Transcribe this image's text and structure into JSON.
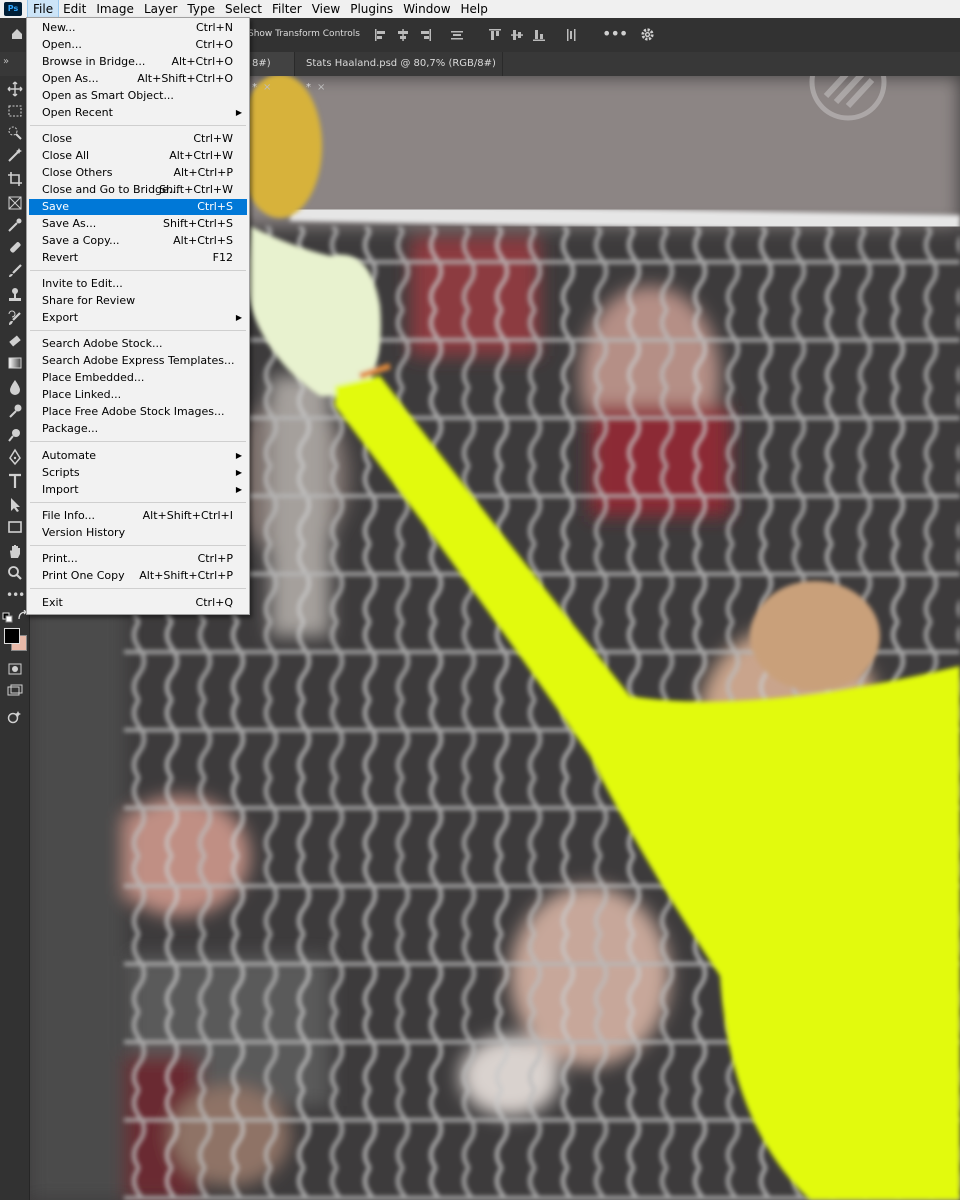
{
  "menubar": {
    "logo": "Ps",
    "items": [
      "File",
      "Edit",
      "Image",
      "Layer",
      "Type",
      "Select",
      "Filter",
      "View",
      "Plugins",
      "Window",
      "Help"
    ]
  },
  "options": {
    "transform_label": "Show Transform Controls"
  },
  "tabs": [
    {
      "label": "8#) *"
    },
    {
      "label": "Stats Haaland.psd @ 80,7% (RGB/8#) *"
    }
  ],
  "file_menu": {
    "items": [
      {
        "label": "New...",
        "shortcut": "Ctrl+N"
      },
      {
        "label": "Open...",
        "shortcut": "Ctrl+O"
      },
      {
        "label": "Browse in Bridge...",
        "shortcut": "Alt+Ctrl+O"
      },
      {
        "label": "Open As...",
        "shortcut": "Alt+Shift+Ctrl+O"
      },
      {
        "label": "Open as Smart Object...",
        "shortcut": ""
      },
      {
        "label": "Open Recent",
        "shortcut": "",
        "submenu": true
      },
      {
        "label": "Close",
        "shortcut": "Ctrl+W"
      },
      {
        "label": "Close All",
        "shortcut": "Alt+Ctrl+W"
      },
      {
        "label": "Close Others",
        "shortcut": "Alt+Ctrl+P"
      },
      {
        "label": "Close and Go to Bridge...",
        "shortcut": "Shift+Ctrl+W"
      },
      {
        "label": "Save",
        "shortcut": "Ctrl+S",
        "highlighted": true
      },
      {
        "label": "Save As...",
        "shortcut": "Shift+Ctrl+S"
      },
      {
        "label": "Save a Copy...",
        "shortcut": "Alt+Ctrl+S"
      },
      {
        "label": "Revert",
        "shortcut": "F12"
      },
      {
        "label": "Invite to Edit...",
        "shortcut": ""
      },
      {
        "label": "Share for Review",
        "shortcut": ""
      },
      {
        "label": "Export",
        "shortcut": "",
        "submenu": true
      },
      {
        "label": "Search Adobe Stock...",
        "shortcut": ""
      },
      {
        "label": "Search Adobe Express Templates...",
        "shortcut": ""
      },
      {
        "label": "Place Embedded...",
        "shortcut": ""
      },
      {
        "label": "Place Linked...",
        "shortcut": ""
      },
      {
        "label": "Place Free Adobe Stock Images...",
        "shortcut": ""
      },
      {
        "label": "Package...",
        "shortcut": ""
      },
      {
        "label": "Automate",
        "shortcut": "",
        "submenu": true
      },
      {
        "label": "Scripts",
        "shortcut": "",
        "submenu": true
      },
      {
        "label": "Import",
        "shortcut": "",
        "submenu": true
      },
      {
        "label": "File Info...",
        "shortcut": "Alt+Shift+Ctrl+I"
      },
      {
        "label": "Version History",
        "shortcut": ""
      },
      {
        "label": "Print...",
        "shortcut": "Ctrl+P"
      },
      {
        "label": "Print One Copy",
        "shortcut": "Alt+Shift+Ctrl+P"
      },
      {
        "label": "Exit",
        "shortcut": "Ctrl+Q"
      }
    ]
  },
  "colors": {
    "accent": "#0078d7",
    "foreground": "#000000",
    "background": "#e8b9a8",
    "jersey": "#e6ff00"
  }
}
